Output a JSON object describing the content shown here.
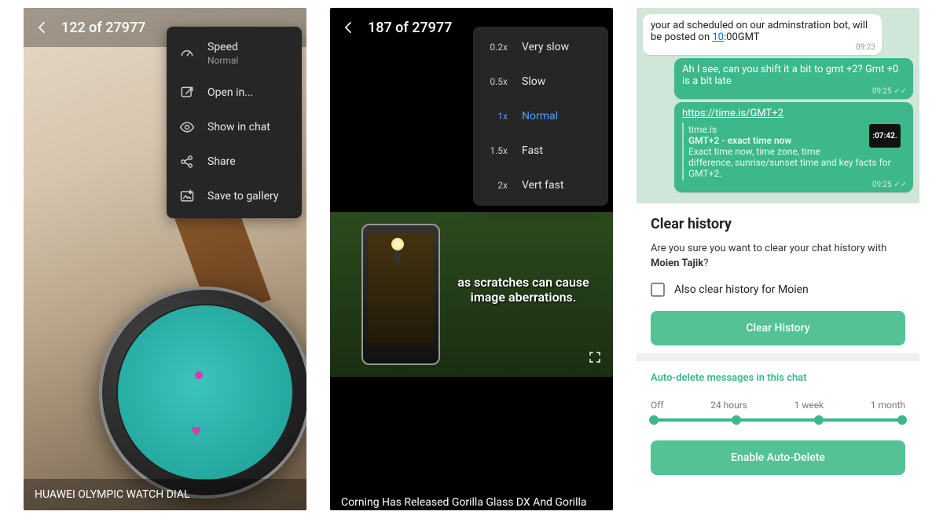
{
  "screen1": {
    "counter": "122 of 27977",
    "menu": {
      "speed": "Speed",
      "speed_sub": "Normal",
      "open_in": "Open in...",
      "show_in_chat": "Show in chat",
      "share": "Share",
      "save": "Save to gallery"
    },
    "caption": "HUAWEI OLYMPIC WATCH DIAL"
  },
  "screen2": {
    "counter": "187 of 27977",
    "speeds": [
      {
        "mult": "0.2x",
        "label": "Very slow"
      },
      {
        "mult": "0.5x",
        "label": "Slow"
      },
      {
        "mult": "1x",
        "label": "Normal"
      },
      {
        "mult": "1.5x",
        "label": "Fast"
      },
      {
        "mult": "2x",
        "label": "Vert fast"
      }
    ],
    "selected_index": 2,
    "video_text": "as scratches can cause image aberrations.",
    "caption": "Corning Has Released Gorilla Glass DX And Gorilla"
  },
  "screen3": {
    "msg_in": {
      "text_a": "your ad scheduled on our adminstration bot, will be posted on ",
      "link_num": "10",
      "text_b": ":00GMT",
      "time": "09:23"
    },
    "msg_out1": {
      "text": "Ah I see, can you shift it a bit to gmt +2? Gmt +0 is a bit late",
      "time": "09:25"
    },
    "msg_out2": {
      "url": "https://time.is/GMT+2",
      "preview_site": "time.is",
      "preview_title": "GMT+2 - exact time now",
      "preview_desc": "Exact time now, time zone, time difference, sunrise/sunset time and key facts for GMT+2.",
      "preview_thumb": ":07:42.",
      "time": "09:25"
    },
    "sheet": {
      "title": "Clear history",
      "body_a": "Are you sure you want to clear your chat history with ",
      "body_name": "Moien Tajik",
      "body_b": "?",
      "checkbox_label": "Also clear history for Moien",
      "btn": "Clear History"
    },
    "auto": {
      "title": "Auto-delete messages in this chat",
      "labels": [
        "Off",
        "24 hours",
        "1 week",
        "1 month"
      ],
      "btn": "Enable Auto-Delete"
    }
  }
}
